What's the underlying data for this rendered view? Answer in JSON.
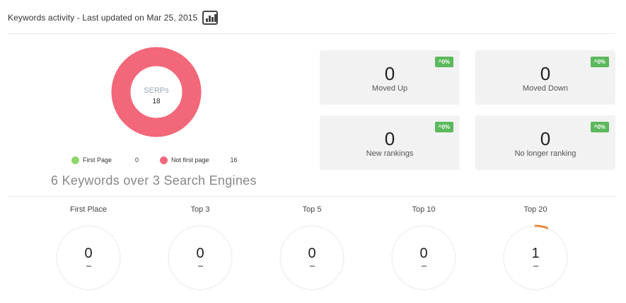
{
  "header": {
    "title": "Keywords activity - Last updated on Mar 25, 2015",
    "chart_icon": "bar-chart-icon"
  },
  "serps": {
    "center_label": "SERPs",
    "center_value": "18",
    "ring_color": "#f2677a",
    "legend": [
      {
        "label": "First Page",
        "count": "0",
        "color": "#8ed66a"
      },
      {
        "label": "Not first page",
        "count": "16",
        "color": "#f2677a"
      }
    ]
  },
  "summary_heading": "6 Keywords over 3 Search Engines",
  "cards": [
    {
      "value": "0",
      "label": "Moved Up",
      "badge": "^0%"
    },
    {
      "value": "0",
      "label": "Moved Down",
      "badge": "^0%"
    },
    {
      "value": "0",
      "label": "New rankings",
      "badge": "^0%"
    },
    {
      "value": "0",
      "label": "No longer ranking",
      "badge": "^0%"
    }
  ],
  "badge_color": "#5cb85c",
  "rankings": [
    {
      "title": "First Place",
      "value": "0",
      "arc_fraction": 0
    },
    {
      "title": "Top 3",
      "value": "0",
      "arc_fraction": 0
    },
    {
      "title": "Top 5",
      "value": "0",
      "arc_fraction": 0
    },
    {
      "title": "Top 10",
      "value": "0",
      "arc_fraction": 0
    },
    {
      "title": "Top 20",
      "value": "1",
      "arc_fraction": 0.06
    }
  ],
  "arc_color": "#e8883a"
}
